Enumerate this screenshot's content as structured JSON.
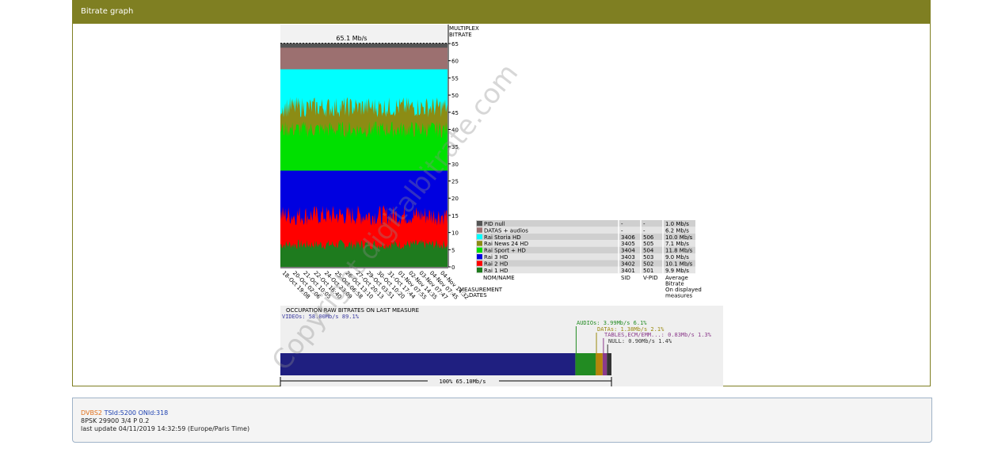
{
  "panel": {
    "title": "Bitrate graph"
  },
  "footer": {
    "standard": "DVBS2",
    "ids": "TSId:5200 ONId:318",
    "modulation": "8PSK 29900 3/4 P 0.2",
    "last_update": "last update 04/11/2019 14:32:59 (Europe/Paris Time)"
  },
  "watermark": "Copyright digitalbitrate.com",
  "chart_data": [
    {
      "type": "area",
      "stacked": true,
      "top_label": "65.1 Mb/s",
      "y_axis_title": [
        "MULTIPLEX",
        "BITRATE"
      ],
      "ylim": [
        0,
        65
      ],
      "y_ticks": [
        "0",
        "5",
        "10",
        "15",
        "20",
        "25",
        "30",
        "35",
        "40",
        "45",
        "50",
        "55",
        "60",
        "65"
      ],
      "x_ticks": [
        "18-Oct 19:08",
        "20-Oct 02:06",
        "21-Oct 10:05",
        "22-Oct 16:40",
        "24-Oct 23:09",
        "25-Oct 06:58",
        "26-Oct 13:10",
        "27-Oct 20:13",
        "29-Oct 03:51",
        "30-Oct 10:20",
        "31-Oct 17:44",
        "01-Nov 07:55",
        "02-Nov 14:35",
        "03-Nov 07:47",
        "04-Nov 07:45",
        "04-Nov 14:32"
      ],
      "x_axis_title": [
        "MEASUREMENT",
        "DATES"
      ],
      "series": [
        {
          "name": "Rai 1 HD",
          "color": "#1e7b1e",
          "base": 6.5,
          "amp": 1.5
        },
        {
          "name": "Rai 2 HD",
          "color": "#ff0000",
          "base": 15.0,
          "amp": 3.0
        },
        {
          "name": "Rai 3 HD",
          "color": "#0000e0",
          "base": 28.0,
          "amp": 0
        },
        {
          "name": "Rai Sport + HD",
          "color": "#00e000",
          "base": 40.0,
          "amp": 2.5
        },
        {
          "name": "Rai News 24 HD",
          "color": "#8c8c14",
          "base": 46.5,
          "amp": 3.0
        },
        {
          "name": "Rai Storia HD",
          "color": "#00ffff",
          "base": 57.5,
          "amp": 0
        },
        {
          "name": "DATAS + audios",
          "color": "#9c7070",
          "base": 63.8,
          "amp": 0
        },
        {
          "name": "PID null",
          "color": "#555555",
          "base": 65.1,
          "amp": 0
        }
      ]
    },
    {
      "type": "table",
      "headers": [
        "NOM/NAME",
        "SID",
        "V-PID",
        "Average Bitrate On displayed measures"
      ],
      "header_lines": {
        "avg": [
          "Average",
          "Bitrate",
          "On displayed",
          "measures"
        ]
      },
      "rows": [
        {
          "color": "#555555",
          "name": "PID null",
          "sid": "-",
          "vpid": "-",
          "avg": "1.0 Mb/s"
        },
        {
          "color": "#9c7070",
          "name": "DATAS + audios",
          "sid": "-",
          "vpid": "-",
          "avg": "6.2 Mb/s"
        },
        {
          "color": "#00ffff",
          "name": "Rai Storia HD",
          "sid": "3406",
          "vpid": "506",
          "avg": "10.0 Mb/s"
        },
        {
          "color": "#8c8c14",
          "name": "Rai News 24 HD",
          "sid": "3405",
          "vpid": "505",
          "avg": "7.1 Mb/s"
        },
        {
          "color": "#00e000",
          "name": "Rai Sport + HD",
          "sid": "3404",
          "vpid": "504",
          "avg": "11.8 Mb/s"
        },
        {
          "color": "#0000e0",
          "name": "Rai 3 HD",
          "sid": "3403",
          "vpid": "503",
          "avg": "9.0 Mb/s"
        },
        {
          "color": "#ff0000",
          "name": "Rai 2 HD",
          "sid": "3402",
          "vpid": "502",
          "avg": "10.1 Mb/s"
        },
        {
          "color": "#1e7b1e",
          "name": "Rai 1 HD",
          "sid": "3401",
          "vpid": "501",
          "avg": "9.9 Mb/s"
        }
      ]
    },
    {
      "type": "bar",
      "stacked": true,
      "title": "OCCUPATION RAW BITRATES ON LAST MEASURE",
      "total_label": "100%  65.10Mb/s",
      "segments": [
        {
          "label": "VIDEOs: 58.00Mb/s  89.1%",
          "value": 58.0,
          "color": "#1f1f80",
          "text_color": "#3a3aa0"
        },
        {
          "label": "AUDIOs: 3.99Mb/s  6.1%",
          "value": 3.99,
          "color": "#228b22",
          "text_color": "#228b22"
        },
        {
          "label": "DATAs: 1.38Mb/s  2.1%",
          "value": 1.38,
          "color": "#b8860b",
          "text_color": "#9a8a10"
        },
        {
          "label": "TABLES,ECM/EMM...: 0.83Mb/s  1.3%",
          "value": 0.83,
          "color": "#8b3a8b",
          "text_color": "#8b3a8b"
        },
        {
          "label": "NULL: 0.90Mb/s  1.4%",
          "value": 0.9,
          "color": "#333333",
          "text_color": "#333333"
        }
      ]
    }
  ]
}
